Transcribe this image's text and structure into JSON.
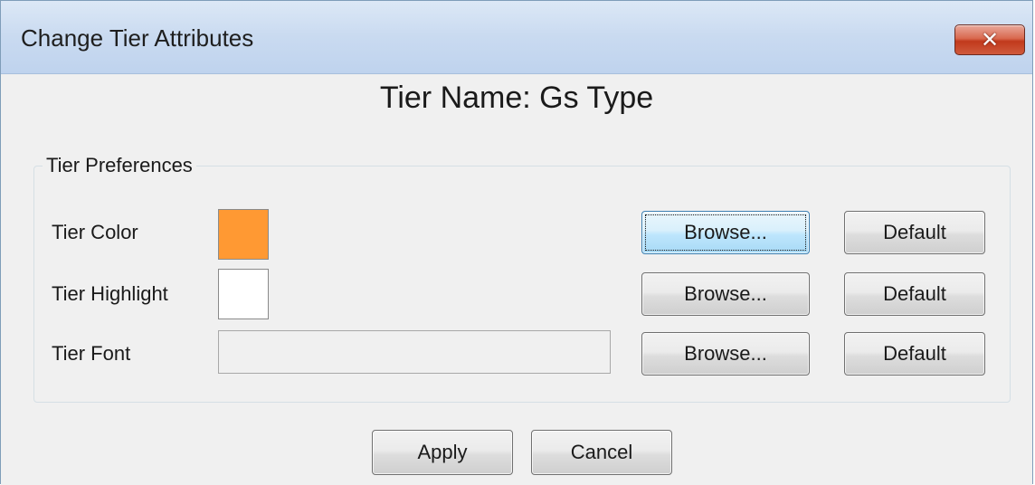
{
  "window": {
    "title": "Change Tier Attributes",
    "close_symbol": "✕"
  },
  "heading": "Tier Name: Gs Type",
  "preferences": {
    "legend": "Tier Preferences",
    "rows": [
      {
        "label": "Tier Color",
        "swatch_color": "#ff9933",
        "browse_label": "Browse...",
        "default_label": "Default"
      },
      {
        "label": "Tier Highlight",
        "swatch_color": "#ffffff",
        "browse_label": "Browse...",
        "default_label": "Default"
      },
      {
        "label": "Tier Font",
        "font_value": "",
        "browse_label": "Browse...",
        "default_label": "Default"
      }
    ]
  },
  "footer": {
    "apply_label": "Apply",
    "cancel_label": "Cancel"
  }
}
